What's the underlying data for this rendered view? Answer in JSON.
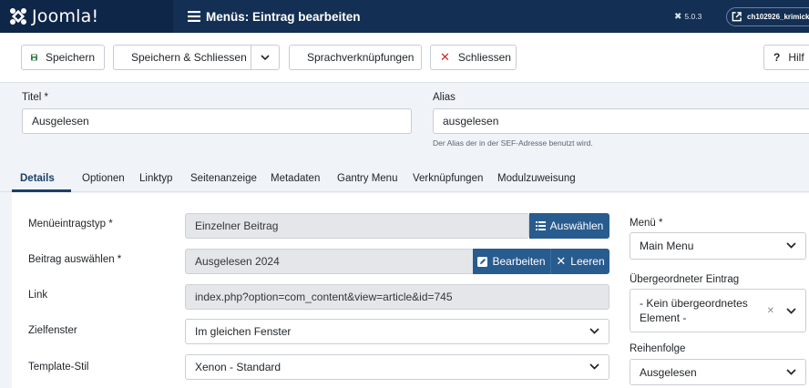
{
  "header": {
    "brand": "Joomla!",
    "title": "Menüs: Eintrag bearbeiten",
    "version": "5.0.3",
    "site_link": "ch102926_krimick"
  },
  "toolbar": {
    "save": "Speichern",
    "save_close": "Speichern & Schliessen",
    "language_links": "Sprachverknüpfungen",
    "close": "Schliessen",
    "help": "Hilf"
  },
  "form": {
    "title_label": "Titel *",
    "title_value": "Ausgelesen",
    "alias_label": "Alias",
    "alias_value": "ausgelesen",
    "alias_hint": "Der Alias der in der SEF-Adresse benutzt wird."
  },
  "tabs": [
    "Details",
    "Optionen",
    "Linktyp",
    "Seitenanzeige",
    "Metadaten",
    "Gantry Menu",
    "Verknüpfungen",
    "Modulzuweisung"
  ],
  "details": {
    "item_type_label": "Menüeintragstyp *",
    "item_type_value": "Einzelner Beitrag",
    "select_button": "Auswählen",
    "article_label": "Beitrag auswählen *",
    "article_value": "Ausgelesen 2024",
    "edit_button": "Bearbeiten",
    "clear_button": "Leeren",
    "link_label": "Link",
    "link_value": "index.php?option=com_content&view=article&id=745",
    "target_label": "Zielfenster",
    "target_value": "Im gleichen Fenster",
    "template_label": "Template-Stil",
    "template_value": "Xenon - Standard"
  },
  "sidebar_right": {
    "menu_label": "Menü *",
    "menu_value": "Main Menu",
    "parent_label": "Übergeordneter Eintrag",
    "parent_value_line1": "- Kein übergeordnetes",
    "parent_value_line2": "Element -",
    "order_label": "Reihenfolge",
    "order_value": "Ausgelesen"
  },
  "colors": {
    "header_bg": "#132f53",
    "primary_button": "#285b8e",
    "save_icon": "#2a7a3b",
    "close_icon": "#c52827"
  }
}
